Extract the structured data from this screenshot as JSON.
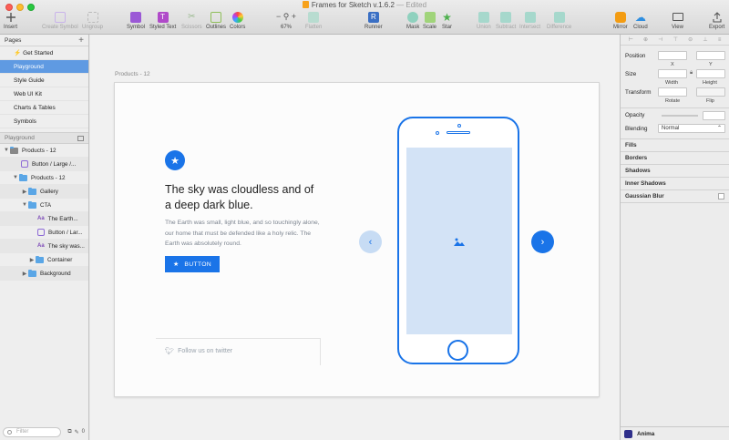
{
  "window": {
    "title": "Frames for Sketch v.1.6.2",
    "status": "— Edited"
  },
  "toolbar": {
    "insert": "Insert",
    "create_symbol": "Create Symbol",
    "ungroup": "Ungroup",
    "symbol": "Symbol",
    "styled_text": "Styled Text",
    "scissors": "Scissors",
    "outlines": "Outlines",
    "colors": "Colors",
    "zoom_value": "67%",
    "flatten": "Flatten",
    "runner": "Runner",
    "mask": "Mask",
    "scale": "Scale",
    "star": "Star",
    "union": "Union",
    "subtract": "Subtract",
    "intersect": "Intersect",
    "difference": "Difference",
    "mirror": "Mirror",
    "cloud": "Cloud",
    "view": "View",
    "export": "Export"
  },
  "sidebar": {
    "pages_label": "Pages",
    "pages": [
      {
        "label": "Get Started"
      },
      {
        "label": "Playground"
      },
      {
        "label": "Style Guide"
      },
      {
        "label": "Web UI Kit"
      },
      {
        "label": "Charts & Tables"
      },
      {
        "label": "Symbols"
      }
    ],
    "layers_header": "Playground",
    "layers": [
      {
        "label": "Products - 12"
      },
      {
        "label": "Button / Large /..."
      },
      {
        "label": "Products - 12"
      },
      {
        "label": "Gallery"
      },
      {
        "label": "CTA"
      },
      {
        "label": "The Earth..."
      },
      {
        "label": "Button / Lar..."
      },
      {
        "label": "The sky was..."
      },
      {
        "label": "Container"
      },
      {
        "label": "Background"
      }
    ],
    "filter_placeholder": "Filter",
    "footer_count": "0"
  },
  "canvas": {
    "artboard_label": "Products - 12",
    "headline": "The sky was cloudless and of a deep dark blue.",
    "body": "The Earth was small, light blue, and so touchingly alone, our home that must be defended like a holy relic. The Earth was absolutely round.",
    "button_label": "BUTTON",
    "follow_text": "Follow us on twitter"
  },
  "inspector": {
    "position": "Position",
    "x": "X",
    "y": "Y",
    "size": "Size",
    "width": "Width",
    "height": "Height",
    "transform": "Transform",
    "rotate": "Rotate",
    "flip": "Flip",
    "opacity": "Opacity",
    "blending": "Blending",
    "blending_value": "Normal",
    "fills": "Fills",
    "borders": "Borders",
    "shadows": "Shadows",
    "inner_shadows": "Inner Shadows",
    "gaussian_blur": "Gaussian Blur",
    "anima": "Anima"
  },
  "colors": {
    "accent": "#1a74e8",
    "selection": "#5f9ae2",
    "screen": "#d3e3f6"
  }
}
